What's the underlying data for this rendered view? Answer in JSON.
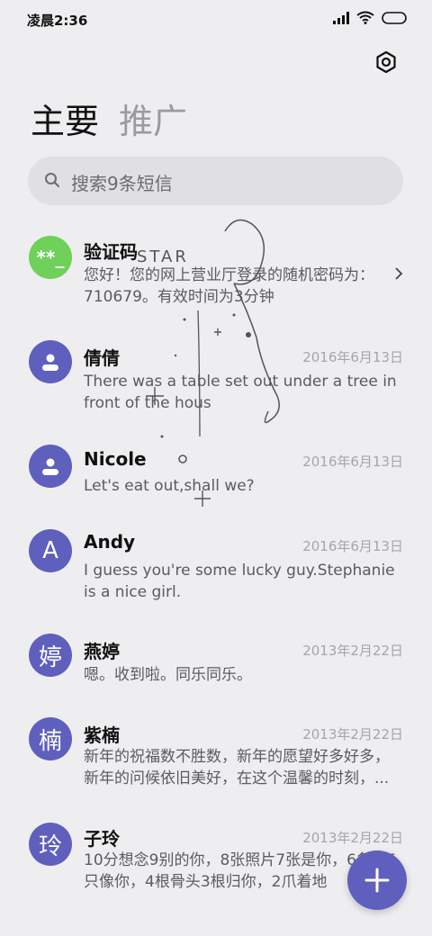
{
  "status_bar": {
    "time": "凌晨2:36"
  },
  "header": {
    "tab_main": "主要",
    "tab_promo": "推广"
  },
  "search": {
    "placeholder": "搜索9条短信"
  },
  "colors": {
    "accent": "#5f5fbd",
    "code_avatar": "#6fd05a",
    "background": "#eeeef0"
  },
  "messages": [
    {
      "avatar_text": "**_",
      "name": "验证码",
      "date": "",
      "preview": "您好！您的网上营业厅登录的随机密码为：710679。有效时间为3分钟"
    },
    {
      "avatar_icon": "person-icon",
      "name": "倩倩",
      "date": "2016年6月13日",
      "preview": "There was a table set out under a tree in front of the hous"
    },
    {
      "avatar_icon": "person-icon",
      "name": "Nicole",
      "date": "2016年6月13日",
      "preview": "Let's eat out,shall we?"
    },
    {
      "avatar_text": "A",
      "name": "Andy",
      "date": "2016年6月13日",
      "preview": "I guess you're some lucky guy.Stephanie is a nice girl."
    },
    {
      "avatar_text": "婷",
      "name": "燕婷",
      "date": "2013年2月22日",
      "preview": "嗯。收到啦。同乐同乐。"
    },
    {
      "avatar_text": "楠",
      "name": "紫楠",
      "date": "2013年2月22日",
      "preview": "新年的祝福数不胜数，新年的愿望好多好多，新年的问候依旧美好，在这个温馨的时刻，..."
    },
    {
      "avatar_text": "玲",
      "name": "子玲",
      "date": "2013年2月22日",
      "preview": "10分想念9别的你，8张照片7张是你，6条狗5只像你，4根骨头3根归你，2爪着地"
    }
  ],
  "watermark": {
    "text": "STAR"
  }
}
